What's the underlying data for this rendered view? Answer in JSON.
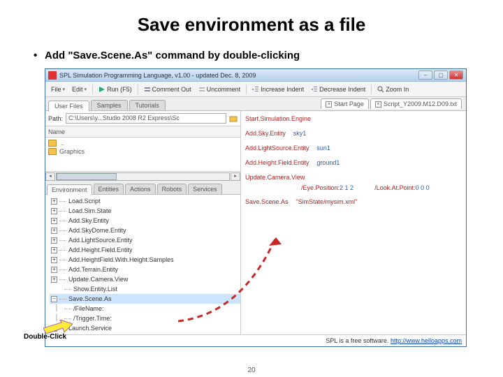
{
  "title": "Save environment as a file",
  "bullet": "Add \"Save.Scene.As\" command by double-clicking",
  "annot": "Double-Click",
  "pagenum": "20",
  "window": {
    "title": "SPL Simulation Programming Language, v1.00 - updated Dec. 8, 2009",
    "menu": {
      "file": "File",
      "edit": "Edit",
      "run": "Run (F5)",
      "commentout": "Comment Out",
      "uncomment": "Uncomment",
      "incindent": "Increase Indent",
      "decindent": "Decrease Indent",
      "zoomin": "Zoom In"
    },
    "tabs": {
      "userfiles": "User Files",
      "samples": "Samples",
      "tutorials": "Tutorials"
    },
    "righttabs": {
      "start": "Start Page",
      "script": "Script_Y2009.M12.D09.txt"
    },
    "path": {
      "label": "Path:",
      "value": "C:\\Users\\y...Studio 2008 R2 Express\\Sc"
    },
    "filehdr": "Name",
    "files": {
      "graphics": "Graphics"
    },
    "btabs": {
      "env": "Environment",
      "entities": "Entities",
      "actions": "Actions",
      "robots": "Robots",
      "services": "Services"
    },
    "tree": [
      "Load.Script",
      "Load.Sim.State",
      "Add.Sky.Entity",
      "Add.SkyDome.Entity",
      "Add.LightSource.Entity",
      "Add.Height.Field.Entity",
      "Add.HeightField.With.Height.Samples",
      "Add.Terrain.Entity",
      "Update.Camera.View",
      "Show.Entity.List",
      "Save.Scene.As",
      "/FileName:",
      "/Trigger.Time:",
      "Launch.Service"
    ],
    "code": {
      "l1k": "Start.Simulation.Engine",
      "l2k": "Add.Sky.Entity",
      "l2a": "sky1",
      "l3k": "Add.LightSource.Entity",
      "l3a": "sun1",
      "l4k": "Add.Height.Field.Entity",
      "l4a": "ground1",
      "l5k": "Update.Camera.View",
      "l5ea": "/Eye.Position:",
      "l5ev": "2 1 2",
      "l5la": "/Look.At.Point:",
      "l5lv": "0 0 0",
      "l6k": "Save.Scene.As",
      "l6s": "\"SimState/mysim.xml\""
    },
    "footer": {
      "text": "SPL is a free software.",
      "link": "http://www.helloapps.com"
    }
  }
}
